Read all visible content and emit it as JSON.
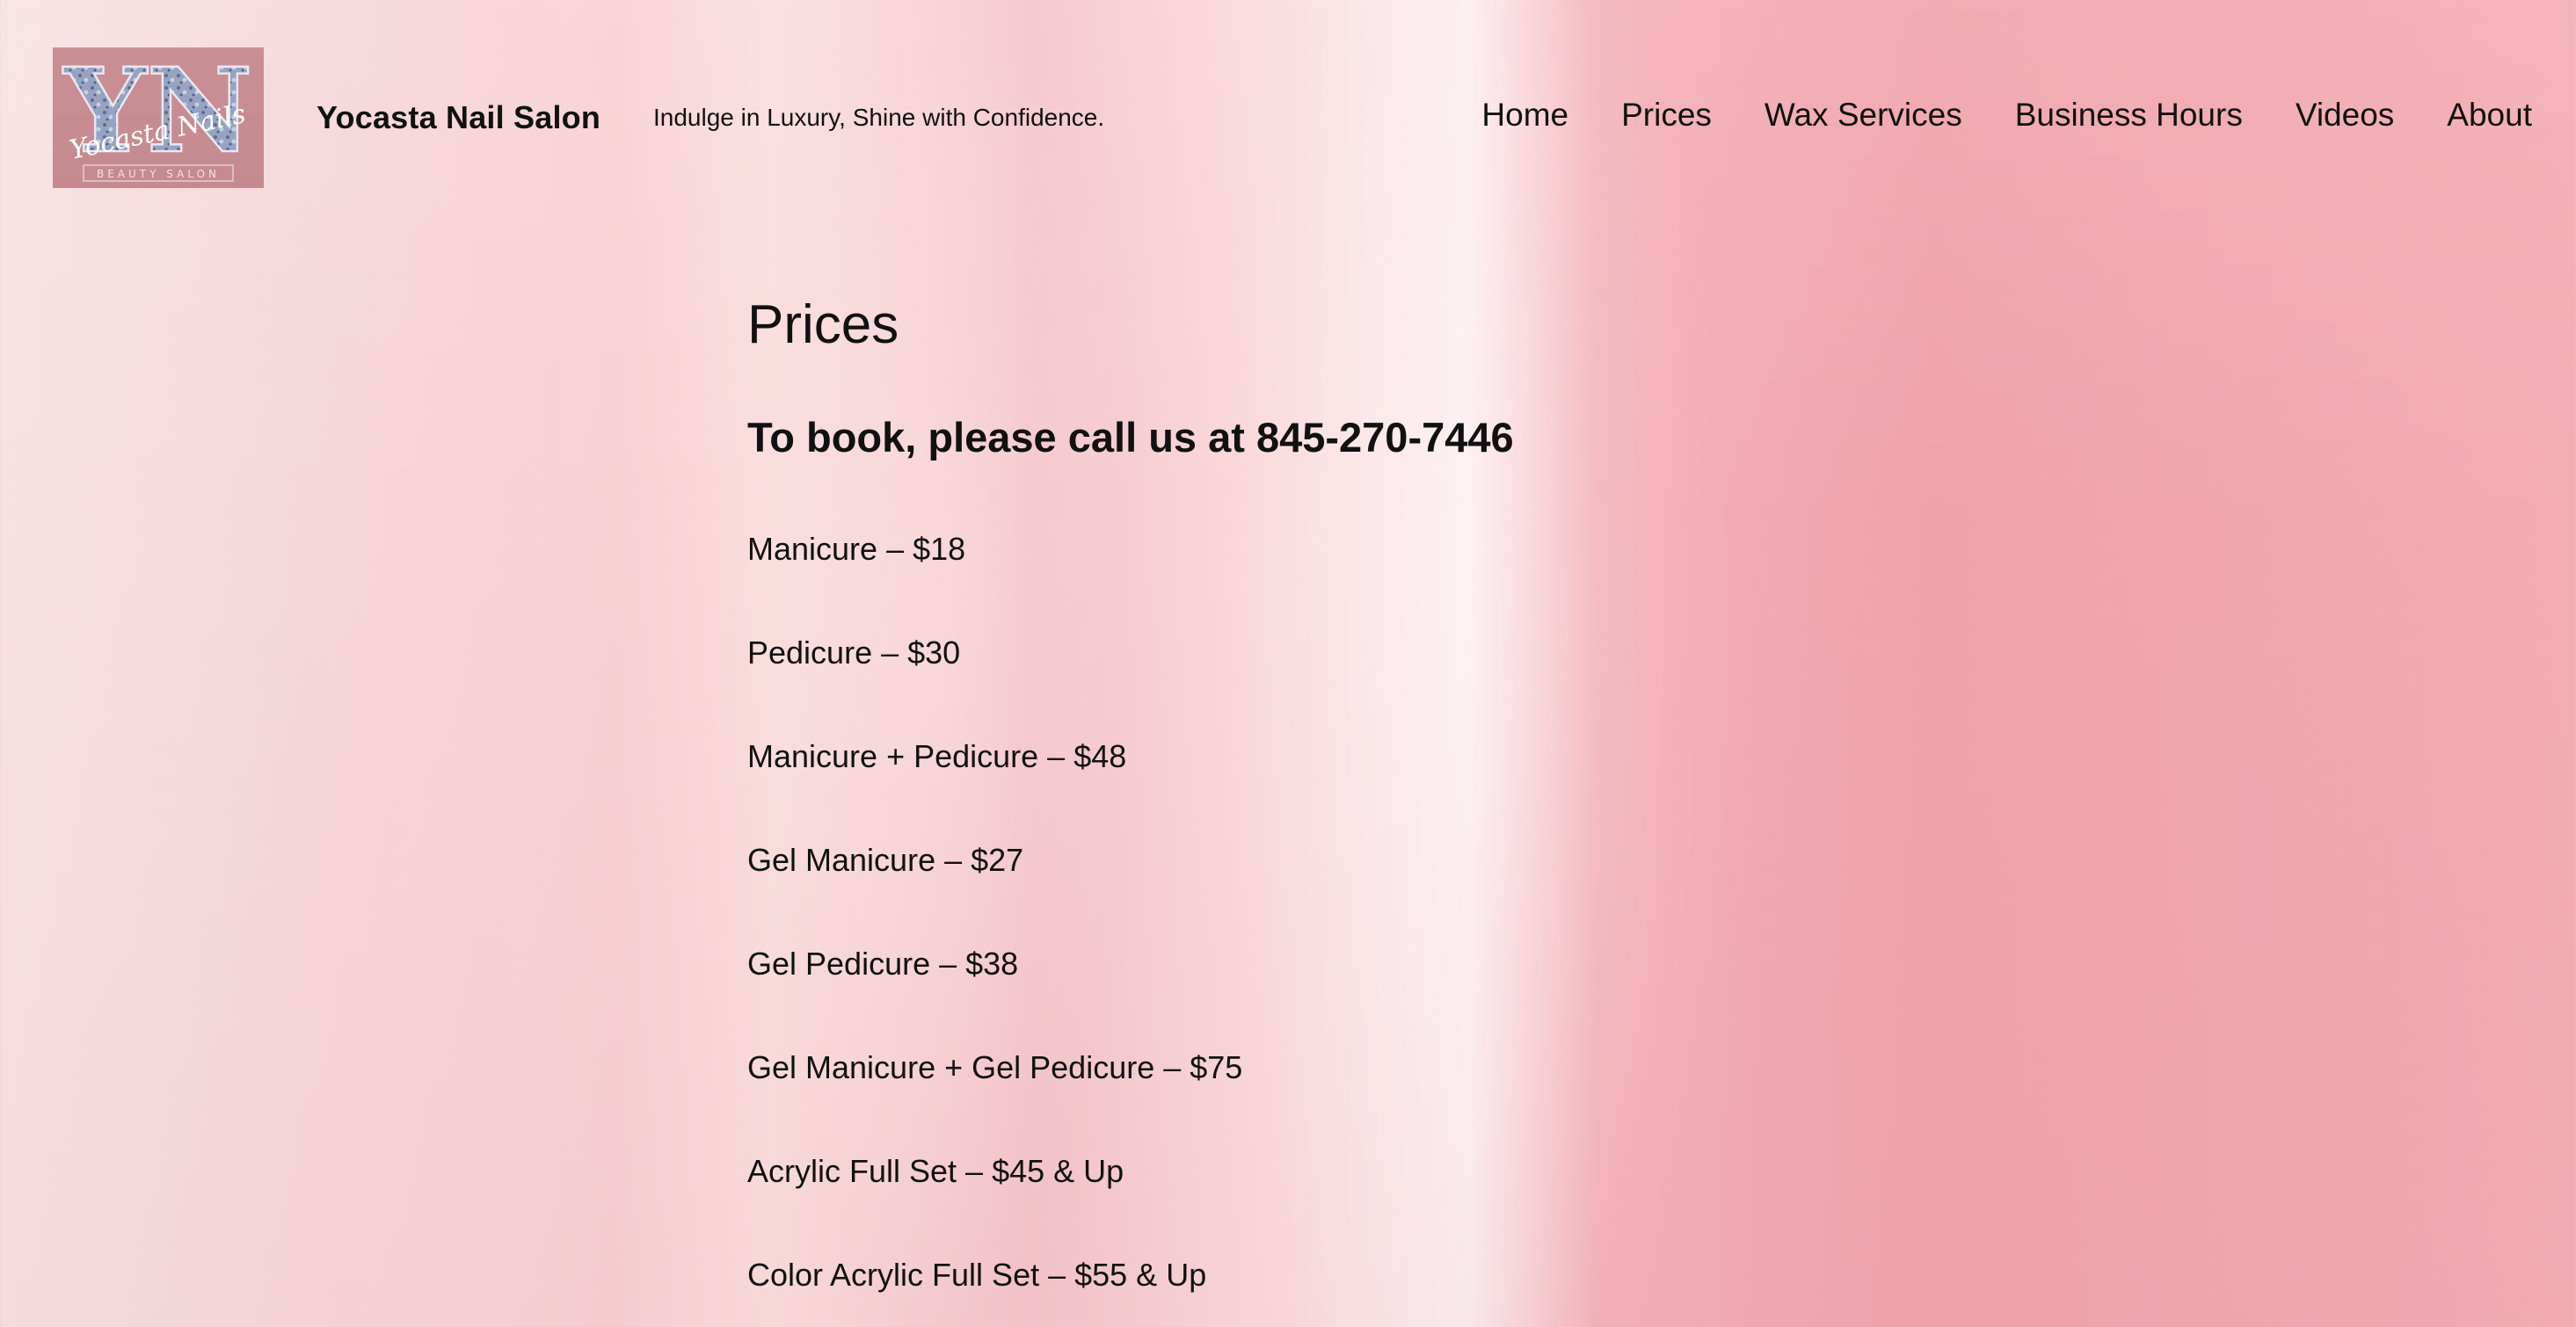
{
  "header": {
    "logo": {
      "monogram": "YN",
      "script_text": "Yocasta Nails",
      "sub_text": "BEAUTY SALON"
    },
    "site_title": "Yocasta Nail Salon",
    "tagline": "Indulge in Luxury, Shine with Confidence.",
    "nav": [
      {
        "label": "Home"
      },
      {
        "label": "Prices"
      },
      {
        "label": "Wax Services"
      },
      {
        "label": "Business Hours"
      },
      {
        "label": "Videos"
      },
      {
        "label": "About"
      }
    ]
  },
  "main": {
    "title": "Prices",
    "booking_text": "To book, please call us at 845-270-7446",
    "prices": [
      "Manicure – $18",
      "Pedicure – $30",
      "Manicure + Pedicure – $48",
      "Gel Manicure – $27",
      "Gel Pedicure – $38",
      "Gel Manicure + Gel Pedicure – $75",
      "Acrylic Full Set – $45 & Up",
      "Color Acrylic Full Set – $55 & Up"
    ]
  },
  "colors": {
    "text": "#111111",
    "logo_bg": "#c98f94",
    "logo_letters": "#8f9bb8",
    "background_left": "#f8e1e2",
    "background_right": "#f2acb2"
  }
}
